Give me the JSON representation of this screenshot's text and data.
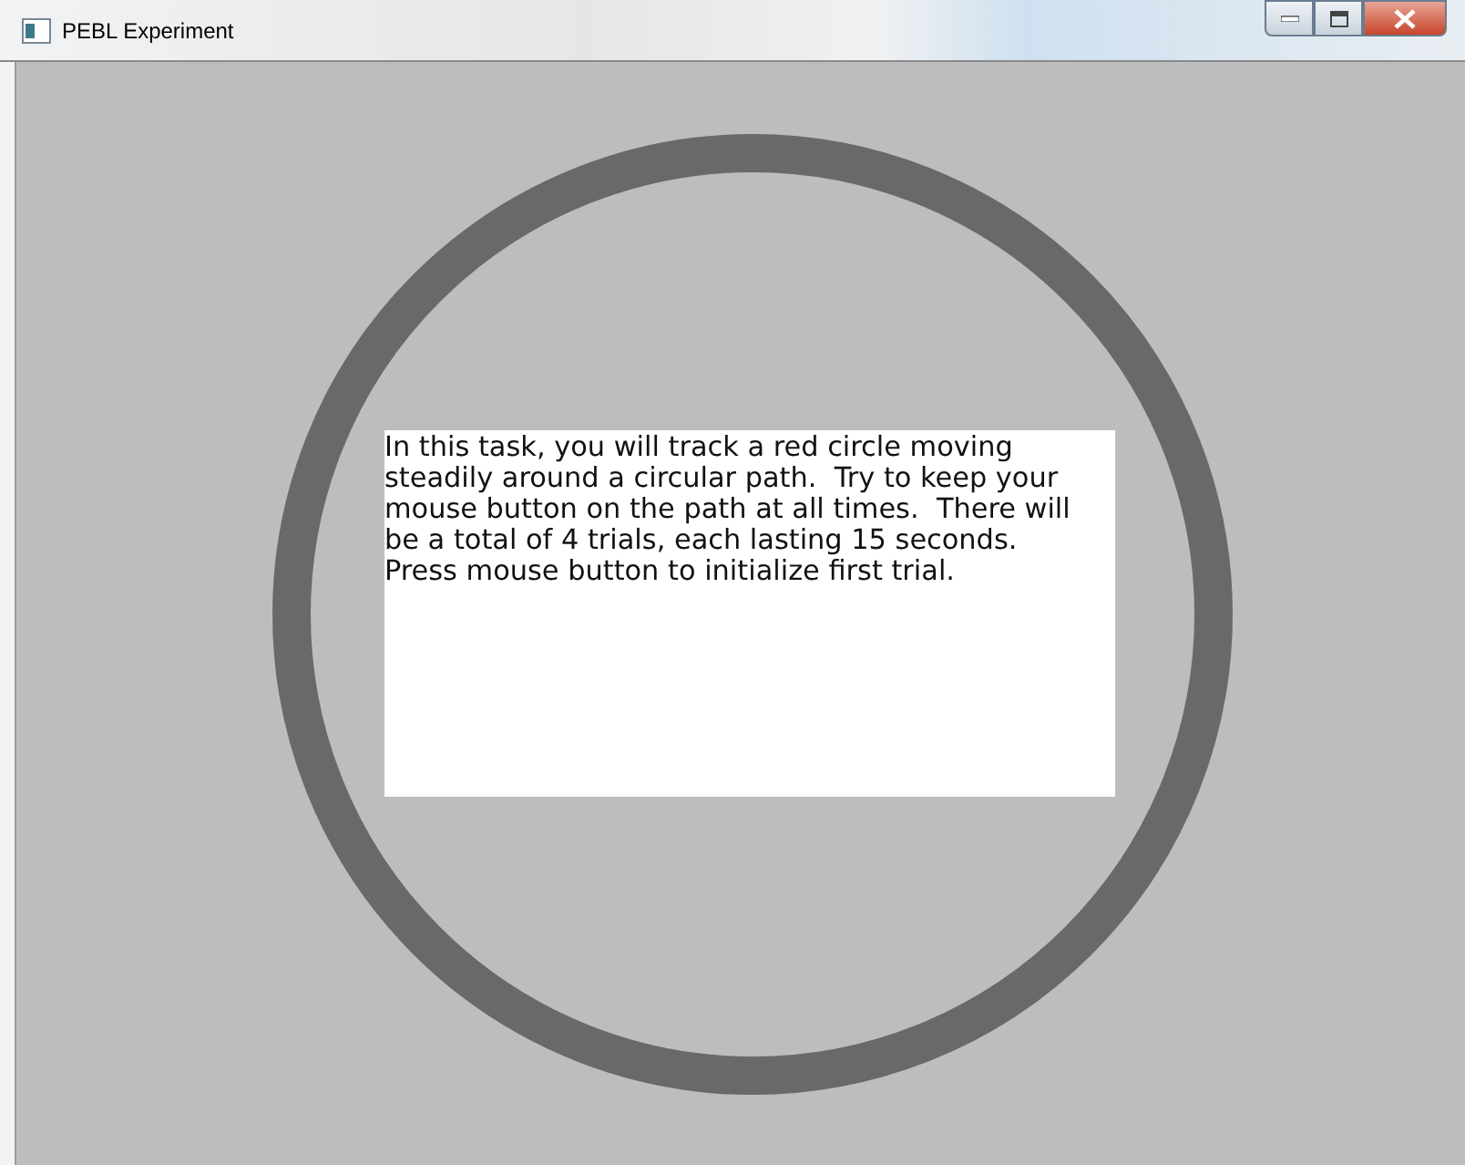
{
  "window": {
    "title": "PEBL Experiment"
  },
  "instructions": {
    "lines": [
      "In this task, you will track a red circle moving",
      "steadily around a circular path.  Try to keep your",
      "mouse button on the path at all times.  There will",
      "be a total of 4 trials, each lasting 15 seconds.",
      "Press mouse button to initialize first trial."
    ]
  }
}
